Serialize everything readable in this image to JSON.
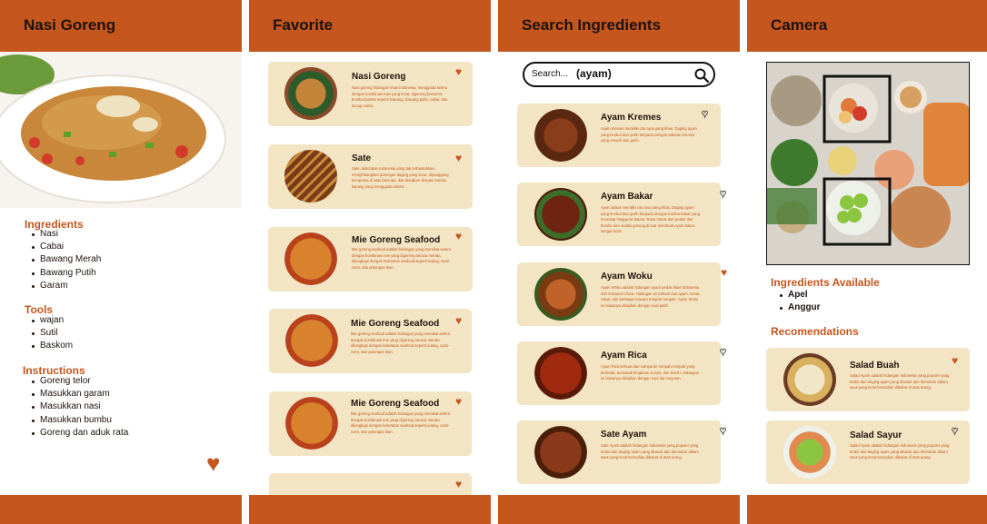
{
  "detail": {
    "title": "Nasi Goreng",
    "ingredients_title": "Ingredients",
    "ingredients": [
      "Nasi",
      "Cabai",
      "Bawang Merah",
      "Bawang Putih",
      "Garam"
    ],
    "tools_title": "Tools",
    "tools": [
      "wajan",
      "Sutil",
      "Baskom"
    ],
    "instructions_title": "Instructions",
    "instructions": [
      "Goreng telor",
      "Masukkan garam",
      "Masukkan nasi",
      "Masukkan bumbu",
      "Goreng dan aduk rata"
    ],
    "favorited": true
  },
  "favorite": {
    "title": "Favorite",
    "items": [
      {
        "name": "Nasi Goreng",
        "desc": "Nasi goreng hidangan khas Indonesia, menggoda selera dengan kombinasi nasi yang lezat, digoreng bersama bumbu-bumbu seperti bawang, bawang putih, cabai, dan kecap manis.",
        "favorited": true
      },
      {
        "name": "Sate",
        "desc": "Sate, kelezatan Indonesia yang tak terbantahkan, menghidangkan potongan daging yang lezat, dipanggang sempurna di atas bara api, dan disajikan dengan bumbu kacang yang menggoda selera.",
        "favorited": true
      },
      {
        "name": "Mie Goreng Seafood",
        "desc": "Mie goreng seafood adalah hidangan yang memikat selera dengan kombinasi mie yang digoreng secara merata, dilengkapi dengan kelezatan seafood seperti udang, cumi-cumi, dan potongan ikan.",
        "favorited": true
      },
      {
        "name": "Mie Goreng Seafood",
        "desc": "Mie goreng seafood adalah hidangan yang memikat selera dengan kombinasi mie yang digoreng secara merata, dilengkapi dengan kelezatan seafood seperti udang, cumi-cumi, dan potongan ikan.",
        "favorited": true
      },
      {
        "name": "Mie Goreng Seafood",
        "desc": "Mie goreng seafood adalah hidangan yang memikat selera dengan kombinasi mie yang digoreng secara merata, dilengkapi dengan kelezatan seafood seperti udang, cumi-cumi, dan potongan ikan.",
        "favorited": true
      }
    ]
  },
  "search": {
    "title": "Search Ingredients",
    "placeholder": "Search...",
    "query": "(ayam)",
    "results": [
      {
        "name": "Ayam Kremes",
        "desc": "Ayam kremes memiliki cita rasa yang khas. Daging ayam yang lembut dan gurih berpadu dengan taburan kremes yang renyah dan gurih.",
        "favorited": false
      },
      {
        "name": "Ayam Bakar",
        "desc": "Ayam bakar memiliki cita rasa yang khas. Daging ayam yang lembut dan gurih berpadu dengan bumbu bakar yang meresap hingga ke dalam. Rasa manis dan pedas dari bumbu dan sedikit gosong di luar membuat ayam bakar sangat lezat.",
        "favorited": false
      },
      {
        "name": "Ayam Woku",
        "desc": "Ayam Woku adalah hidangan ayam pedas khas Indonesia dari Sulawesi Utara. Hidangan ini terbuat dari ayam, tomat, cabai, dan berbagai macam rempah-rempah. Ayam Woku ini biasanya disajikan dengan nasi putih.",
        "favorited": true
      },
      {
        "name": "Ayam Rica",
        "desc": "Ayam Rica terbuat dari campuran rempah-rempah yang berbeda, termasuk lengkuas, kunyit, dan kemiri. Hidangan ini biasanya disajikan dengan nasi dan sayuran.",
        "favorited": false
      },
      {
        "name": "Sate Ayam",
        "desc": "Sate Ayam adalah hidangan Indonesia yang populer yang terdiri dari daging ayam yang ditusuk dan direndam dalam saus yang lezat kemudian dibakar di atas arang.",
        "favorited": false
      }
    ]
  },
  "camera": {
    "title": "Camera",
    "available_title": "Ingredients Available",
    "available": [
      "Apel",
      "Anggur"
    ],
    "recommendations_title": "Recomendations",
    "recommendations": [
      {
        "name": "Salad Buah",
        "desc": "Salad Ayam adalah hidangan Indonesia yang populer yang terdiri dari daging ayam yang ditusuk dan direndam dalam saus yang lezat kemudian dibakar di atas arang.",
        "favorited": true
      },
      {
        "name": "Salad Sayur",
        "desc": "Salad Ayam adalah hidangan Indonesia yang populer yang terdiri dari daging ayam yang ditusuk dan direndam dalam saus yang lezat kemudian dibakar di atas arang.",
        "favorited": false
      }
    ]
  },
  "colors": {
    "accent": "#c4561e",
    "card": "#f3e5c4",
    "title": "#1e120c"
  }
}
